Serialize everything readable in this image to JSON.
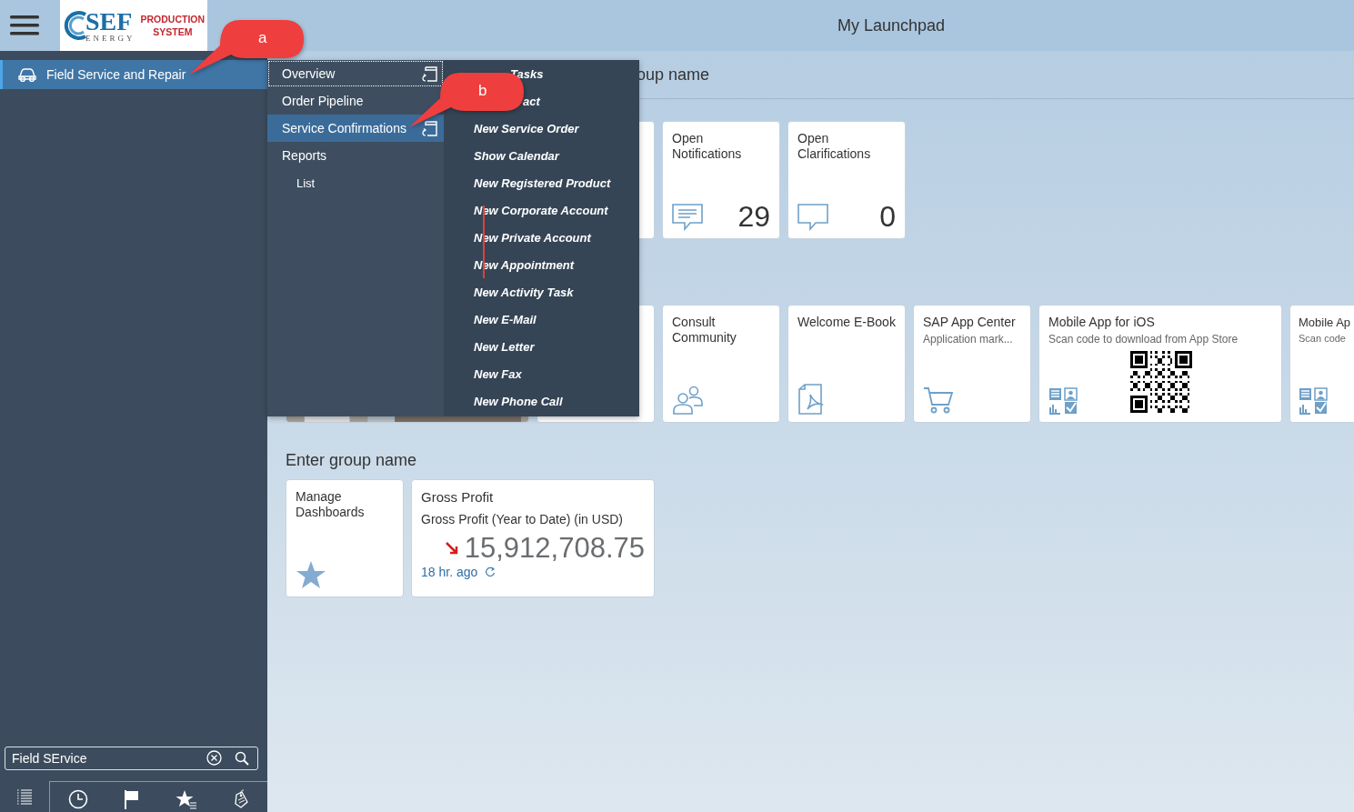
{
  "header": {
    "title": "My Launchpad",
    "logo": {
      "mark": "SEF",
      "sub": "ENERGY",
      "line_1": "PRODUCTION",
      "line_2": "SYSTEM"
    }
  },
  "sidebar": {
    "items": [
      {
        "label": "Field Service and Repair",
        "selected": true
      }
    ],
    "search": {
      "value": "Field SErvice"
    }
  },
  "menu": {
    "items": [
      {
        "label": "Overview",
        "selected": false,
        "focused": true,
        "launch": true,
        "kind": "top"
      },
      {
        "label": "Order Pipeline",
        "selected": false,
        "focused": false,
        "launch": false,
        "kind": "top"
      },
      {
        "label": "Service Confirmations",
        "selected": true,
        "focused": false,
        "launch": true,
        "kind": "top"
      },
      {
        "label": "Reports",
        "selected": false,
        "focused": false,
        "launch": false,
        "kind": "top"
      },
      {
        "label": "List",
        "selected": false,
        "focused": false,
        "launch": false,
        "kind": "sub"
      }
    ],
    "actions": [
      {
        "kind": "heading",
        "parts": [
          "Tasks"
        ]
      },
      {
        "kind": "covered",
        "parts": [
          "act"
        ]
      },
      {
        "kind": "action",
        "parts": [
          "New Service Order"
        ]
      },
      {
        "kind": "action",
        "parts": [
          "Show Calendar"
        ]
      },
      {
        "kind": "action",
        "parts": [
          "New Registered Product"
        ]
      },
      {
        "kind": "action",
        "parts": [
          "New Corporate Account"
        ]
      },
      {
        "kind": "action",
        "parts": [
          "New Private Account"
        ]
      },
      {
        "kind": "action",
        "parts": [
          "New Appointment"
        ]
      },
      {
        "kind": "action",
        "parts": [
          "New Activity Task"
        ]
      },
      {
        "kind": "action",
        "parts": [
          "New E-Mail"
        ]
      },
      {
        "kind": "action",
        "parts": [
          "New Letter"
        ]
      },
      {
        "kind": "action",
        "parts": [
          "New Fax"
        ]
      },
      {
        "kind": "action",
        "parts": [
          "New Phone Call"
        ]
      }
    ]
  },
  "groups": [
    {
      "title": "oup name",
      "tiles": [
        {
          "kind": "blank"
        },
        {
          "kind": "notifications",
          "title": "Open Notifications",
          "count": "29"
        },
        {
          "kind": "clarifications",
          "title": "Open Clarifications",
          "count": "0"
        }
      ]
    },
    {
      "tiles": [
        {
          "kind": "picture"
        },
        {
          "kind": "blank"
        },
        {
          "kind": "people",
          "title": "Consult Community"
        },
        {
          "kind": "document",
          "title": "Welcome E-Book"
        },
        {
          "kind": "cart",
          "title": "SAP App Center",
          "subtitle": "Application mark..."
        },
        {
          "kind": "qr",
          "title": "Mobile App for iOS",
          "subtitle": "Scan code to download from App Store"
        },
        {
          "kind": "qr-cut",
          "title": "Mobile Ap",
          "subtitle": "Scan code"
        }
      ]
    },
    {
      "title": "Enter group name",
      "tiles": [
        {
          "kind": "star",
          "title": "Manage Dashboards"
        },
        {
          "kind": "kpi",
          "title": "Gross Profit",
          "subtitle": "Gross Profit (Year to Date) (in USD)",
          "value": "15,912,708.75",
          "falling": true,
          "age": "18 hr. ago"
        }
      ]
    }
  ],
  "callouts": [
    {
      "label": "a"
    },
    {
      "label": "b"
    }
  ]
}
